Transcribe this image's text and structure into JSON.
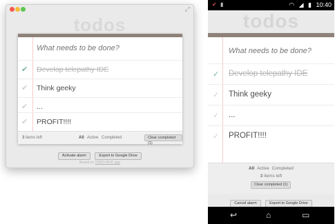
{
  "desktop": {
    "app_title": "todos",
    "new_todo_placeholder": "What needs to be done?",
    "todos": [
      {
        "label": "Develop telepathy IDE",
        "completed": true
      },
      {
        "label": "Think geeky",
        "completed": false
      },
      {
        "label": "...",
        "completed": false
      },
      {
        "label": "PROFIT!!!!",
        "completed": false
      }
    ],
    "items_left_count": "3",
    "items_left_suffix": "items left",
    "filters": {
      "all": "All",
      "active": "Active",
      "completed": "Completed"
    },
    "clear_completed": "Clear completed (1)",
    "buttons": {
      "activate_alarm": "Activate alarm",
      "export_drive": "Export to Google Drive"
    },
    "based_on_prefix": "Based on",
    "based_on_link": "TODO MVC app"
  },
  "phone": {
    "status_time": "10:40",
    "app_title": "todos",
    "new_todo_placeholder": "What needs to be done?",
    "todos": [
      {
        "label": "Develop telepathy IDE",
        "completed": true
      },
      {
        "label": "Think geeky",
        "completed": false
      },
      {
        "label": "...",
        "completed": false
      },
      {
        "label": "PROFIT!!!!",
        "completed": false
      }
    ],
    "filters": {
      "all": "All",
      "active": "Active",
      "completed": "Completed"
    },
    "items_left_count": "3",
    "items_left_suffix": "items left",
    "clear_completed": "Clear completed (1)",
    "buttons": {
      "cancel_alarm": "Cancel alarm",
      "export_drive": "Export to Google Drive"
    }
  },
  "colors": {
    "band": "#8d8179",
    "check_done": "#75b399",
    "margin_line": "#f4cccc"
  }
}
